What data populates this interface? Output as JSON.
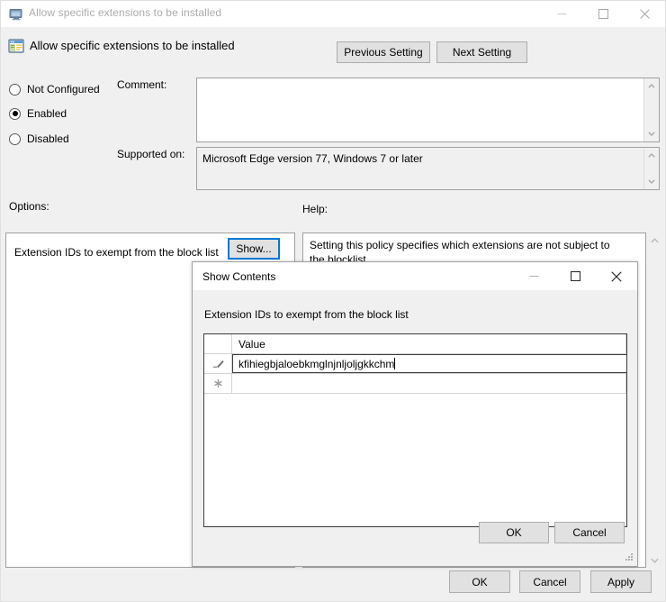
{
  "main_window": {
    "title": "Allow specific extensions to be installed",
    "title_icon": "policy-window-icon",
    "controls": {
      "minimize": "minimize-icon",
      "maximize": "maximize-icon",
      "close": "close-icon"
    },
    "policy_header": {
      "icon": "policy-setting-icon",
      "title": "Allow specific extensions to be installed"
    },
    "nav": {
      "previous": "Previous Setting",
      "next": "Next Setting"
    },
    "state_options": [
      {
        "label": "Not Configured",
        "selected": false
      },
      {
        "label": "Enabled",
        "selected": true
      },
      {
        "label": "Disabled",
        "selected": false
      }
    ],
    "comment": {
      "label": "Comment:",
      "value": "",
      "placeholder": ""
    },
    "supported_on": {
      "label": "Supported on:",
      "value": "Microsoft Edge version 77, Windows 7 or later"
    },
    "options": {
      "label": "Options:",
      "item_label": "Extension IDs to exempt from the block list",
      "show_button": "Show..."
    },
    "help": {
      "label": "Help:",
      "text": "Setting this policy specifies which extensions are not subject to the blocklist."
    },
    "footer_buttons": {
      "ok": "OK",
      "cancel": "Cancel",
      "apply": "Apply"
    }
  },
  "show_contents_dialog": {
    "title": "Show Contents",
    "controls": {
      "minimize": "minimize-icon",
      "maximize": "maximize-icon",
      "close": "close-icon"
    },
    "caption": "Extension IDs to exempt from the block list",
    "grid": {
      "columns": [
        "",
        "Value"
      ],
      "rows": [
        {
          "indicator": "edit-pencil-icon",
          "value": "kfihiegbjaloebkmglnjnljoljgkkchm",
          "editing": true
        },
        {
          "indicator": "new-row-asterisk-icon",
          "value": "",
          "editing": false
        }
      ]
    },
    "buttons": {
      "ok": "OK",
      "cancel": "Cancel"
    },
    "resize_grip": "resize-grip-icon"
  },
  "colors": {
    "window_bg": "#f0f0f0",
    "titlebar_bg": "#ffffff",
    "inactive_title_text": "#acacac",
    "focus_border": "#0078d7",
    "button_face": "#e1e1e1",
    "button_border": "#adadad",
    "field_border": "#a0a0a0"
  }
}
